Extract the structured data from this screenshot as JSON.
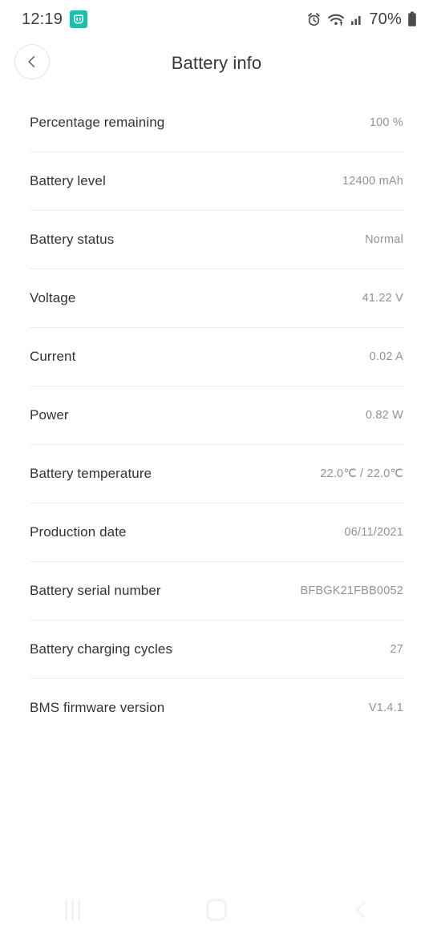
{
  "status_bar": {
    "time": "12:19",
    "app_badge_icon": "mi-home-icon",
    "alarm_icon": "alarm-clock-icon",
    "wifi_icon": "wifi-icon",
    "signal_icon": "cellular-signal-icon",
    "battery_percent": "70%",
    "battery_icon": "battery-icon"
  },
  "header": {
    "back_icon": "chevron-left-icon",
    "title": "Battery info"
  },
  "list": {
    "rows": [
      {
        "label": "Percentage remaining",
        "value": "100 %"
      },
      {
        "label": "Battery level",
        "value": "12400 mAh"
      },
      {
        "label": "Battery status",
        "value": "Normal"
      },
      {
        "label": "Voltage",
        "value": "41.22 V"
      },
      {
        "label": "Current",
        "value": "0.02 A"
      },
      {
        "label": "Power",
        "value": "0.82 W"
      },
      {
        "label": "Battery temperature",
        "value": "22.0℃ / 22.0℃"
      },
      {
        "label": "Production date",
        "value": "06/11/2021"
      },
      {
        "label": "Battery serial number",
        "value": "BFBGK21FBB0052"
      },
      {
        "label": "Battery charging cycles",
        "value": "27"
      },
      {
        "label": "BMS firmware version",
        "value": "V1.4.1"
      }
    ]
  },
  "nav_bar": {
    "recents_icon": "recents-icon",
    "home_icon": "home-icon",
    "back_icon": "back-chevron-icon"
  },
  "colors": {
    "accent": "#14c2ae",
    "label_text": "#303438",
    "value_text": "#8e9396",
    "divider": "#eeeeee",
    "background": "#ffffff"
  }
}
